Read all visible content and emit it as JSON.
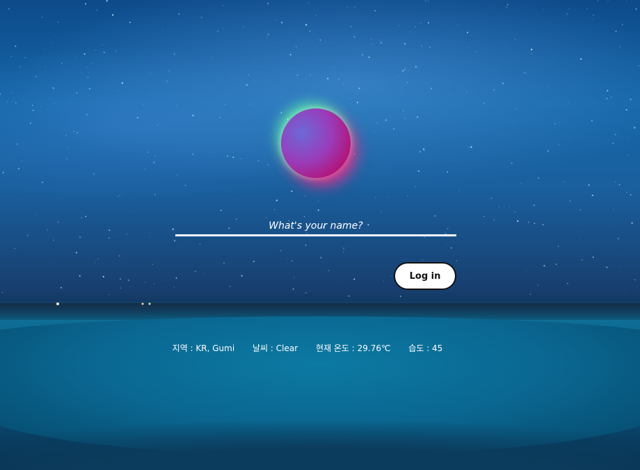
{
  "login": {
    "name_placeholder": "What's your name?",
    "login_label": "Log in"
  },
  "weather": {
    "region": "지역 : KR, Gumi",
    "condition": "날씨 : Clear",
    "temperature": "현재 온도 : 29.76℃",
    "humidity": "습도 : 45"
  },
  "colors": {
    "orb_core": "#b0177d",
    "orb_glow_top": "#64ffaa",
    "orb_glow_bottom": "#ff288c",
    "button_bg": "#ffffff",
    "text": "#ffffff"
  }
}
